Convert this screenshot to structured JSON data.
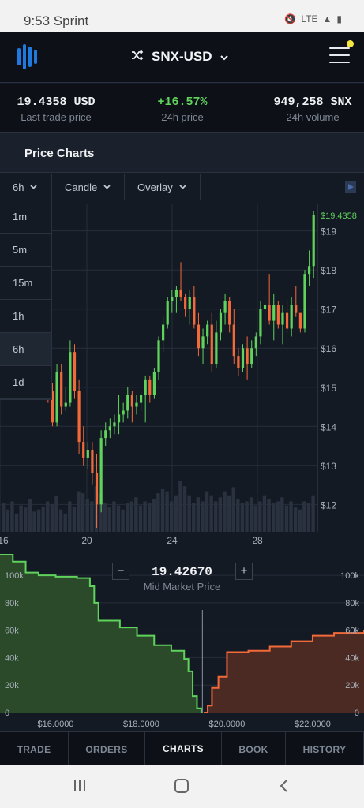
{
  "status_bar": {
    "time": "9:53 Sprint",
    "network": "LTE"
  },
  "header": {
    "pair": "SNX-USD"
  },
  "ticker": {
    "last_price": "19.4358 USD",
    "last_price_label": "Last trade price",
    "change": "+16.57%",
    "change_label": "24h price",
    "volume": "949,258 SNX",
    "volume_label": "24h volume"
  },
  "section_title": "Price Charts",
  "toolbar": {
    "interval": "6h",
    "chart_type": "Candle",
    "overlay": "Overlay"
  },
  "interval_options": [
    "1m",
    "5m",
    "15m",
    "1h",
    "6h",
    "1d"
  ],
  "active_interval": "6h",
  "colors": {
    "up": "#5fd35c",
    "down": "#f2693a",
    "accent": "#1f7ae0",
    "bid_fill": "#2a4a2a",
    "ask_fill": "#4a2a22"
  },
  "chart_data": [
    {
      "type": "candlestick",
      "x_ticks": [
        "16",
        "20",
        "24",
        "28"
      ],
      "y_ticks": [
        "$12",
        "$13",
        "$14",
        "$15",
        "$16",
        "$17",
        "$18",
        "$19"
      ],
      "ylim": [
        11.3,
        19.7
      ],
      "last_price_label": "$19.4358",
      "candles": [
        [
          15.9,
          16.6,
          15.7,
          16.1
        ],
        [
          16.1,
          16.2,
          15.8,
          16.0
        ],
        [
          16.0,
          16.6,
          15.9,
          16.4
        ],
        [
          16.4,
          16.5,
          15.9,
          16.2
        ],
        [
          16.2,
          16.8,
          16.0,
          16.5
        ],
        [
          16.5,
          16.9,
          16.1,
          16.8
        ],
        [
          16.8,
          16.9,
          16.0,
          16.2
        ],
        [
          16.2,
          16.5,
          15.8,
          16.1
        ],
        [
          16.1,
          16.2,
          15.3,
          15.4
        ],
        [
          15.4,
          15.9,
          15.0,
          15.8
        ],
        [
          15.8,
          16.0,
          14.6,
          14.9
        ],
        [
          14.9,
          15.1,
          14.0,
          14.1
        ],
        [
          14.1,
          15.6,
          14.0,
          15.4
        ],
        [
          15.4,
          15.6,
          14.3,
          14.5
        ],
        [
          14.5,
          15.0,
          14.4,
          14.6
        ],
        [
          14.6,
          16.2,
          14.5,
          15.9
        ],
        [
          15.9,
          16.1,
          14.7,
          14.9
        ],
        [
          14.9,
          15.2,
          13.3,
          13.6
        ],
        [
          13.6,
          14.0,
          13.0,
          13.2
        ],
        [
          13.2,
          13.6,
          12.9,
          13.4
        ],
        [
          13.4,
          13.6,
          12.5,
          12.8
        ],
        [
          12.8,
          13.3,
          11.4,
          12.0
        ],
        [
          12.0,
          13.9,
          11.8,
          13.7
        ],
        [
          13.7,
          14.1,
          13.5,
          13.9
        ],
        [
          13.9,
          14.2,
          13.7,
          14.0
        ],
        [
          14.0,
          14.3,
          13.8,
          14.1
        ],
        [
          14.1,
          14.8,
          13.8,
          14.3
        ],
        [
          14.3,
          14.6,
          14.1,
          14.4
        ],
        [
          14.4,
          15.0,
          14.2,
          14.8
        ],
        [
          14.8,
          14.9,
          14.1,
          14.5
        ],
        [
          14.5,
          14.8,
          14.3,
          14.6
        ],
        [
          14.6,
          14.9,
          14.4,
          14.8
        ],
        [
          14.8,
          15.3,
          14.1,
          15.2
        ],
        [
          15.2,
          15.3,
          14.6,
          14.8
        ],
        [
          14.8,
          15.5,
          14.7,
          15.4
        ],
        [
          15.4,
          16.3,
          15.2,
          16.2
        ],
        [
          16.2,
          16.8,
          15.9,
          16.6
        ],
        [
          16.6,
          17.3,
          16.5,
          17.2
        ],
        [
          17.2,
          17.5,
          16.9,
          17.3
        ],
        [
          17.3,
          17.6,
          16.9,
          17.5
        ],
        [
          17.5,
          18.2,
          17.2,
          17.3
        ],
        [
          17.3,
          17.4,
          16.8,
          17.0
        ],
        [
          17.0,
          17.5,
          16.6,
          17.3
        ],
        [
          17.3,
          17.6,
          16.5,
          16.6
        ],
        [
          16.6,
          16.9,
          15.8,
          16.0
        ],
        [
          16.0,
          16.5,
          15.6,
          16.3
        ],
        [
          16.3,
          16.7,
          16.1,
          16.6
        ],
        [
          16.6,
          16.9,
          15.4,
          15.6
        ],
        [
          15.6,
          16.7,
          15.5,
          16.4
        ],
        [
          16.4,
          17.0,
          16.2,
          16.9
        ],
        [
          16.9,
          17.4,
          16.6,
          17.2
        ],
        [
          17.2,
          17.3,
          16.4,
          16.6
        ],
        [
          16.6,
          17.0,
          15.6,
          15.8
        ],
        [
          15.8,
          16.0,
          15.3,
          15.5
        ],
        [
          15.5,
          16.1,
          15.4,
          16.0
        ],
        [
          16.0,
          16.3,
          15.2,
          15.6
        ],
        [
          15.6,
          16.2,
          15.5,
          16.0
        ],
        [
          16.0,
          16.4,
          15.8,
          16.3
        ],
        [
          16.3,
          17.2,
          16.1,
          17.0
        ],
        [
          17.0,
          17.3,
          16.5,
          17.1
        ],
        [
          17.1,
          17.9,
          16.6,
          16.7
        ],
        [
          16.7,
          17.4,
          16.2,
          17.1
        ],
        [
          17.1,
          17.2,
          16.5,
          16.6
        ],
        [
          16.6,
          17.1,
          16.1,
          16.9
        ],
        [
          16.9,
          17.2,
          16.4,
          16.5
        ],
        [
          16.5,
          17.3,
          16.3,
          17.1
        ],
        [
          17.1,
          17.6,
          16.8,
          16.9
        ],
        [
          16.9,
          16.9,
          16.4,
          16.5
        ],
        [
          16.5,
          18.0,
          16.4,
          17.9
        ],
        [
          17.9,
          18.5,
          17.6,
          18.1
        ],
        [
          18.1,
          19.5,
          17.8,
          19.4
        ]
      ],
      "volumes": [
        28,
        22,
        30,
        18,
        26,
        24,
        32,
        20,
        22,
        25,
        30,
        27,
        35,
        22,
        18,
        30,
        25,
        40,
        38,
        32,
        30,
        45,
        38,
        28,
        24,
        30,
        26,
        22,
        28,
        30,
        34,
        26,
        30,
        28,
        32,
        38,
        42,
        40,
        30,
        36,
        50,
        45,
        36,
        28,
        34,
        30,
        40,
        36,
        30,
        34,
        40,
        36,
        44,
        32,
        28,
        30,
        34,
        26,
        30,
        36,
        32,
        28,
        30,
        34,
        26,
        30,
        24,
        22,
        30,
        28,
        36
      ]
    },
    {
      "type": "area",
      "x_ticks": [
        "$16.0000",
        "$18.0000",
        "$20.0000",
        "$22.0000"
      ],
      "y_ticks_left": [
        "0",
        "20k",
        "40k",
        "60k",
        "80k",
        "100k"
      ],
      "y_ticks_right": [
        "0",
        "20k",
        "40k",
        "60k",
        "80k",
        "100k"
      ],
      "xlim": [
        14.7,
        23.2
      ],
      "ylim": [
        0,
        115000
      ],
      "mid_market_price": "19.42670",
      "mid_label": "Mid Market Price",
      "bids": [
        [
          14.7,
          115000
        ],
        [
          15.0,
          110000
        ],
        [
          15.3,
          102000
        ],
        [
          15.6,
          100000
        ],
        [
          16.0,
          99000
        ],
        [
          16.5,
          98000
        ],
        [
          16.8,
          92000
        ],
        [
          16.9,
          80000
        ],
        [
          17.0,
          67000
        ],
        [
          17.5,
          62000
        ],
        [
          17.9,
          56000
        ],
        [
          18.3,
          49000
        ],
        [
          18.7,
          45000
        ],
        [
          19.0,
          39000
        ],
        [
          19.1,
          30000
        ],
        [
          19.2,
          12000
        ],
        [
          19.3,
          3000
        ],
        [
          19.4,
          0
        ]
      ],
      "asks": [
        [
          19.46,
          0
        ],
        [
          19.55,
          5000
        ],
        [
          19.65,
          18000
        ],
        [
          19.8,
          26000
        ],
        [
          20.0,
          44000
        ],
        [
          20.5,
          45000
        ],
        [
          21.0,
          48000
        ],
        [
          21.5,
          52000
        ],
        [
          22.0,
          56000
        ],
        [
          22.5,
          58000
        ],
        [
          23.2,
          60000
        ]
      ]
    }
  ],
  "bottom_nav": [
    "TRADE",
    "ORDERS",
    "CHARTS",
    "BOOK",
    "HISTORY"
  ],
  "active_tab": "CHARTS"
}
